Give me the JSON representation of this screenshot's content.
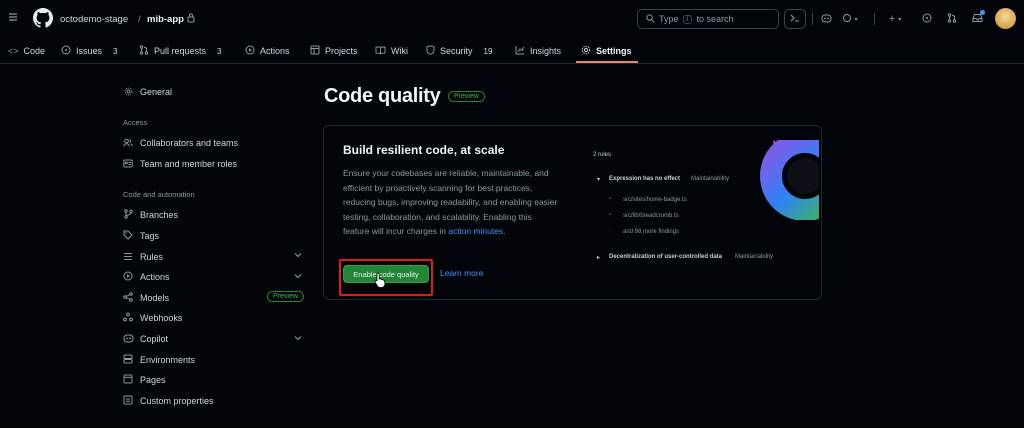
{
  "header": {
    "owner": "octodemo-stage",
    "separator": "/",
    "repo": "mib-app",
    "search_prefix": "Type",
    "search_key": "/",
    "search_suffix": "to search",
    "plus_label": "+",
    "colors": {
      "bg": "#010409",
      "border": "#3d444d"
    }
  },
  "repo_nav": {
    "tabs": [
      {
        "label": "Code",
        "icon": "code-icon"
      },
      {
        "label": "Issues",
        "count": "3",
        "icon": "issue-icon"
      },
      {
        "label": "Pull requests",
        "count": "3",
        "icon": "pull-request-icon"
      },
      {
        "label": "Actions",
        "icon": "play-icon"
      },
      {
        "label": "Projects",
        "icon": "table-icon"
      },
      {
        "label": "Wiki",
        "icon": "book-icon"
      },
      {
        "label": "Security",
        "count": "19",
        "icon": "shield-icon"
      },
      {
        "label": "Insights",
        "icon": "graph-icon"
      },
      {
        "label": "Settings",
        "icon": "gear-icon",
        "selected": true
      }
    ],
    "accent": "#f78166"
  },
  "sidebar": {
    "general": "General",
    "access_heading": "Access",
    "collaborators": "Collaborators and teams",
    "team_roles": "Team and member roles",
    "code_heading": "Code and automation",
    "branches": "Branches",
    "tags": "Tags",
    "rules": "Rules",
    "actions": "Actions",
    "models": "Models",
    "models_badge": "Preview",
    "webhooks": "Webhooks",
    "copilot": "Copilot",
    "environments": "Environments",
    "pages": "Pages",
    "custom_properties": "Custom properties"
  },
  "main": {
    "title": "Code quality",
    "title_badge": "Preview",
    "card": {
      "heading": "Build resilient code, at scale",
      "description": "Ensure your codebases are reliable, maintainable, and efficient by proactively scanning for best practices, reducing bugs, improving readability, and enabling easier testing, collaboration, and scalability. Enabling this feature will incur charges in",
      "description_link": "action minutes",
      "description_end": ".",
      "enable_button": "Enable code quality",
      "learn_more": "Learn more",
      "preview": {
        "rules_count": "2 rules",
        "rule1": "Expression has no effect",
        "rule1_tag": "Maintainability",
        "file1": "src/sites/home-badge.ts",
        "file2": "src/lib/breadcrumb.ts",
        "more_findings": "and 98 more findings",
        "rule2": "Decentralization of user-controlled data",
        "rule2_tag": "Maintainability"
      }
    },
    "colors": {
      "primary": "#238636",
      "link": "#4493f8",
      "highlight": "#e5171f"
    }
  }
}
